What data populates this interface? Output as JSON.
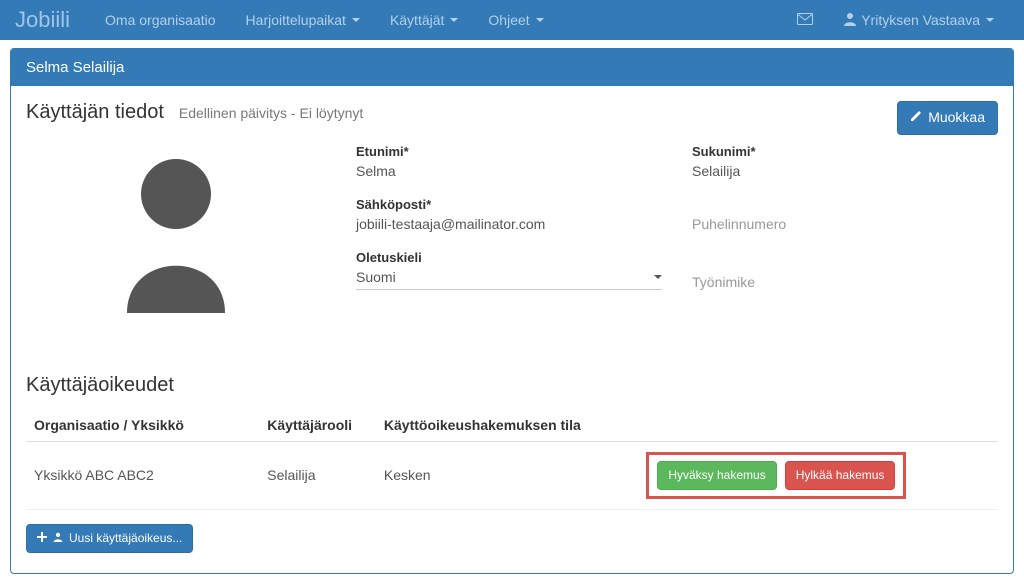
{
  "nav": {
    "brand": "Jobiili",
    "items": [
      {
        "label": "Oma organisaatio",
        "has_caret": false
      },
      {
        "label": "Harjoittelupaikat",
        "has_caret": true
      },
      {
        "label": "Käyttäjät",
        "has_caret": true
      },
      {
        "label": "Ohjeet",
        "has_caret": true
      }
    ],
    "user_menu_label": "Yrityksen Vastaava"
  },
  "panel": {
    "heading": "Selma Selailija",
    "title": "Käyttäjän tiedot",
    "subtitle": "Edellinen päivitys - Ei löytynyt",
    "edit_label": "Muokkaa"
  },
  "user": {
    "firstname_label": "Etunimi*",
    "firstname": "Selma",
    "lastname_label": "Sukunimi*",
    "lastname": "Selailija",
    "email_label": "Sähköposti*",
    "email": "jobiili-testaaja@mailinator.com",
    "phone_label": "",
    "phone_placeholder": "Puhelinnumero",
    "lang_label": "Oletuskieli",
    "lang_value": "Suomi",
    "jobtitle_placeholder": "Työnimike"
  },
  "permissions": {
    "section_title": "Käyttäjäoikeudet",
    "columns": {
      "org": "Organisaatio / Yksikkö",
      "role": "Käyttäjärooli",
      "status": "Käyttöoikeushakemuksen tila",
      "actions": ""
    },
    "rows": [
      {
        "org": "Yksikkö ABC ABC2",
        "role": "Selailija",
        "status": "Kesken",
        "approve_label": "Hyväksy hakemus",
        "reject_label": "Hylkää hakemus"
      }
    ],
    "add_label": "Uusi käyttäjäoikeus..."
  }
}
